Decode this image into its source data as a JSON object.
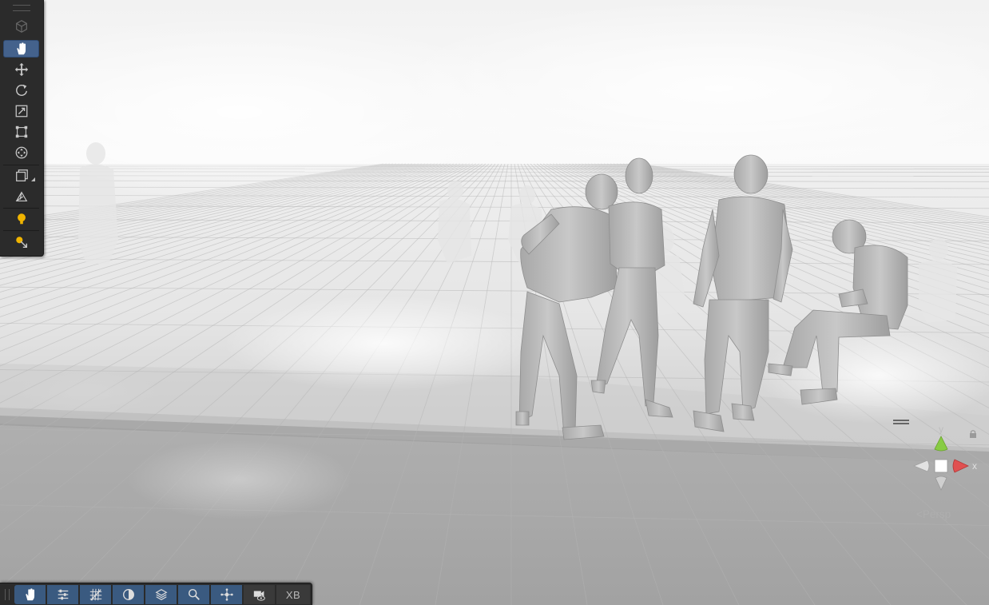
{
  "scene": {
    "sky_color": "#f4f4f4",
    "floor_color": "#a9a9a9",
    "figure_color": "#b2b2b2",
    "accent_colors": {
      "x_axis": "#e05050",
      "y_axis": "#88cc44",
      "active_button": "#44628c"
    }
  },
  "left_toolbar": {
    "tools": [
      {
        "name": "view-options",
        "icon": "cube-icon",
        "active": false
      },
      {
        "name": "view-tool",
        "icon": "hand-icon",
        "active": true
      },
      {
        "name": "move-tool",
        "icon": "move-arrows-icon",
        "active": false
      },
      {
        "name": "rotate-tool",
        "icon": "rotate-icon",
        "active": false
      },
      {
        "name": "scale-tool",
        "icon": "scale-icon",
        "active": false
      },
      {
        "name": "rect-tool",
        "icon": "rect-transform-icon",
        "active": false
      },
      {
        "name": "transform-tool",
        "icon": "transform-icon",
        "active": false
      },
      {
        "name": "draw-mode",
        "icon": "shaded-box-icon",
        "active": false
      },
      {
        "name": "view-mode",
        "icon": "wireframe-icon",
        "active": false
      },
      {
        "name": "lighting-toggle",
        "icon": "lightbulb-icon",
        "active": false
      },
      {
        "name": "light-probe",
        "icon": "light-probe-icon",
        "active": false
      }
    ]
  },
  "bottom_toolbar": {
    "buttons": [
      {
        "name": "pan-button",
        "icon": "hand-icon"
      },
      {
        "name": "settings-button",
        "icon": "sliders-icon"
      },
      {
        "name": "grid-button",
        "icon": "grid-icon"
      },
      {
        "name": "shading-button",
        "icon": "half-circle-icon"
      },
      {
        "name": "layers-button",
        "icon": "layers-icon"
      },
      {
        "name": "search-button",
        "icon": "search-icon"
      },
      {
        "name": "pivot-button",
        "icon": "pivot-icon"
      },
      {
        "name": "camera-button",
        "icon": "camera-eye-icon"
      }
    ],
    "xr_label": "XB"
  },
  "orientation_gizmo": {
    "y_label": "y",
    "x_label": "x",
    "projection_label": "Persp",
    "projection_arrow": "<"
  }
}
